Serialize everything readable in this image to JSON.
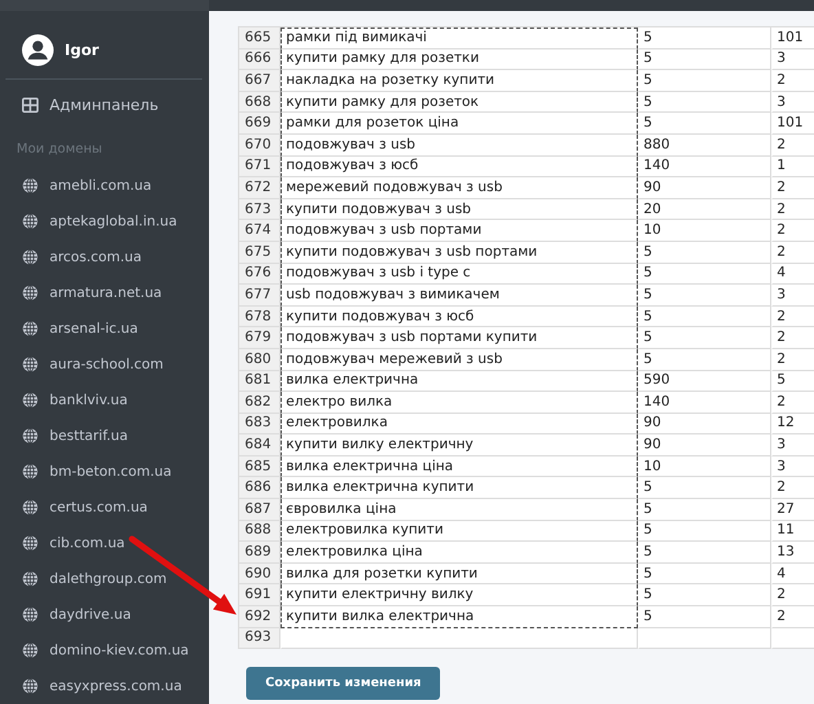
{
  "user": {
    "name": "Igor"
  },
  "nav": [
    {
      "label": "Админпанель"
    }
  ],
  "domains_heading": "Мои домены",
  "domains": [
    "amebli.com.ua",
    "aptekaglobal.in.ua",
    "arcos.com.ua",
    "armatura.net.ua",
    "arsenal-ic.ua",
    "aura-school.com",
    "banklviv.ua",
    "besttarif.ua",
    "bm-beton.com.ua",
    "certus.com.ua",
    "cib.com.ua",
    "dalethgroup.com",
    "daydrive.ua",
    "domino-kiev.com.ua",
    "easyxpress.com.ua"
  ],
  "table": {
    "rows": [
      {
        "num": "665",
        "keyword": "рамки під вимикачі",
        "column_3": "5",
        "column_4": "101",
        "selected": true
      },
      {
        "num": "666",
        "keyword": "купити рамку для розетки",
        "column_3": "5",
        "column_4": "3",
        "selected": true
      },
      {
        "num": "667",
        "keyword": "накладка на розетку купити",
        "column_3": "5",
        "column_4": "2",
        "selected": true
      },
      {
        "num": "668",
        "keyword": "купити рамку для розеток",
        "column_3": "5",
        "column_4": "3",
        "selected": true
      },
      {
        "num": "669",
        "keyword": "рамки для розеток ціна",
        "column_3": "5",
        "column_4": "101",
        "selected": true
      },
      {
        "num": "670",
        "keyword": "подовжувач з usb",
        "column_3": "880",
        "column_4": "2",
        "selected": true
      },
      {
        "num": "671",
        "keyword": "подовжувач з юсб",
        "column_3": "140",
        "column_4": "1",
        "selected": true
      },
      {
        "num": "672",
        "keyword": "мережевий подовжувач з usb",
        "column_3": "90",
        "column_4": "2",
        "selected": true
      },
      {
        "num": "673",
        "keyword": "купити подовжувач з usb",
        "column_3": "20",
        "column_4": "2",
        "selected": true
      },
      {
        "num": "674",
        "keyword": "подовжувач з usb портами",
        "column_3": "10",
        "column_4": "2",
        "selected": true
      },
      {
        "num": "675",
        "keyword": "купити подовжувач з usb портами",
        "column_3": "5",
        "column_4": "2",
        "selected": true
      },
      {
        "num": "676",
        "keyword": "подовжувач з usb і type c",
        "column_3": "5",
        "column_4": "4",
        "selected": true
      },
      {
        "num": "677",
        "keyword": "usb подовжувач з вимикачем",
        "column_3": "5",
        "column_4": "3",
        "selected": true
      },
      {
        "num": "678",
        "keyword": "купити подовжувач з юсб",
        "column_3": "5",
        "column_4": "2",
        "selected": true
      },
      {
        "num": "679",
        "keyword": "подовжувач з usb портами купити",
        "column_3": "5",
        "column_4": "2",
        "selected": true
      },
      {
        "num": "680",
        "keyword": "подовжувач мережевий з usb",
        "column_3": "5",
        "column_4": "2",
        "selected": true
      },
      {
        "num": "681",
        "keyword": "вилка електрична",
        "column_3": "590",
        "column_4": "5",
        "selected": true
      },
      {
        "num": "682",
        "keyword": "електро вилка",
        "column_3": "140",
        "column_4": "2",
        "selected": true
      },
      {
        "num": "683",
        "keyword": "електровилка",
        "column_3": "90",
        "column_4": "12",
        "selected": true
      },
      {
        "num": "684",
        "keyword": "купити вилку електричну",
        "column_3": "90",
        "column_4": "3",
        "selected": true
      },
      {
        "num": "685",
        "keyword": "вилка електрична ціна",
        "column_3": "10",
        "column_4": "3",
        "selected": true
      },
      {
        "num": "686",
        "keyword": "вилка електрична купити",
        "column_3": "5",
        "column_4": "2",
        "selected": true
      },
      {
        "num": "687",
        "keyword": "євровилка ціна",
        "column_3": "5",
        "column_4": "27",
        "selected": true
      },
      {
        "num": "688",
        "keyword": "електровилка купити",
        "column_3": "5",
        "column_4": "11",
        "selected": true
      },
      {
        "num": "689",
        "keyword": "електровилка ціна",
        "column_3": "5",
        "column_4": "13",
        "selected": true
      },
      {
        "num": "690",
        "keyword": "вилка для розетки купити",
        "column_3": "5",
        "column_4": "4",
        "selected": true
      },
      {
        "num": "691",
        "keyword": "купити електричну вилку",
        "column_3": "5",
        "column_4": "2",
        "selected": true
      },
      {
        "num": "692",
        "keyword": "купити вилка електрична",
        "column_3": "5",
        "column_4": "2",
        "selected": true
      },
      {
        "num": "693",
        "selected": false
      }
    ]
  },
  "save_button": "Сохранить изменения",
  "annotation": {
    "kind": "arrow"
  }
}
